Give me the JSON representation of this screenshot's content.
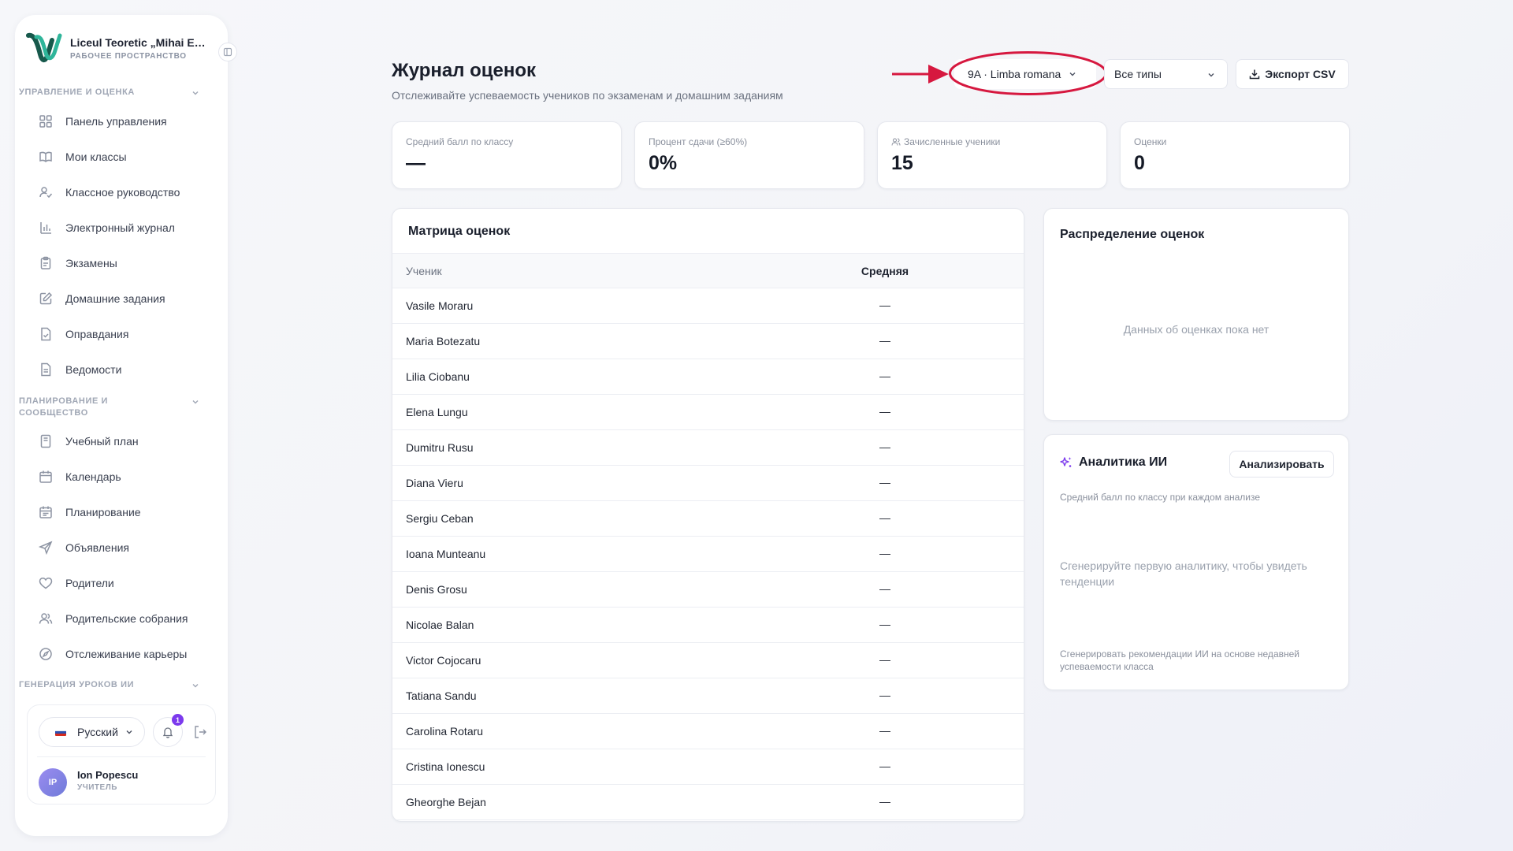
{
  "sidebar": {
    "school_name": "Liceul Teoretic „Mihai Emi...",
    "workspace_label": "РАБОЧЕЕ ПРОСТРАНСТВО",
    "sections": [
      {
        "title": "УПРАВЛЕНИЕ И ОЦЕНКА"
      },
      {
        "title": "ПЛАНИРОВАНИЕ И СООБЩЕСТВО"
      },
      {
        "title": "ГЕНЕРАЦИЯ УРОКОВ ИИ"
      }
    ],
    "items": [
      {
        "label": "Панель управления",
        "icon": "dashboard-icon"
      },
      {
        "label": "Мои классы",
        "icon": "book-icon"
      },
      {
        "label": "Классное руководство",
        "icon": "user-check-icon"
      },
      {
        "label": "Электронный журнал",
        "icon": "bar-chart-icon"
      },
      {
        "label": "Экзамены",
        "icon": "clipboard-icon"
      },
      {
        "label": "Домашние задания",
        "icon": "edit-note-icon"
      },
      {
        "label": "Оправдания",
        "icon": "file-check-icon"
      },
      {
        "label": "Ведомости",
        "icon": "file-text-icon"
      },
      {
        "label": "Учебный план",
        "icon": "notebook-icon"
      },
      {
        "label": "Календарь",
        "icon": "calendar-icon"
      },
      {
        "label": "Планирование",
        "icon": "calendar-check-icon"
      },
      {
        "label": "Объявления",
        "icon": "send-icon"
      },
      {
        "label": "Родители",
        "icon": "heart-icon"
      },
      {
        "label": "Родительские собрания",
        "icon": "users-icon"
      },
      {
        "label": "Отслеживание карьеры",
        "icon": "compass-icon"
      }
    ],
    "language": "Русский",
    "notifications_count": "1",
    "user": {
      "initials": "IP",
      "name": "Ion Popescu",
      "role": "УЧИТЕЛЬ"
    }
  },
  "header": {
    "title": "Журнал оценок",
    "subtitle": "Отслеживайте успеваемость учеников по экзаменам и домашним заданиям",
    "class_select": "9A · Limba romana",
    "type_select": "Все типы",
    "export_label": "Экспорт CSV"
  },
  "stats": [
    {
      "label": "Средний балл по классу",
      "value": "—"
    },
    {
      "label": "Процент сдачи (≥60%)",
      "value": "0%"
    },
    {
      "label": "Зачисленные ученики",
      "value": "15"
    },
    {
      "label": "Оценки",
      "value": "0"
    }
  ],
  "matrix": {
    "title": "Матрица оценок",
    "col_student": "Ученик",
    "col_average": "Средняя",
    "rows": [
      {
        "name": "Vasile Moraru",
        "avg": "—"
      },
      {
        "name": "Maria Botezatu",
        "avg": "—"
      },
      {
        "name": "Lilia Ciobanu",
        "avg": "—"
      },
      {
        "name": "Elena Lungu",
        "avg": "—"
      },
      {
        "name": "Dumitru Rusu",
        "avg": "—"
      },
      {
        "name": "Diana Vieru",
        "avg": "—"
      },
      {
        "name": "Sergiu Ceban",
        "avg": "—"
      },
      {
        "name": "Ioana Munteanu",
        "avg": "—"
      },
      {
        "name": "Denis Grosu",
        "avg": "—"
      },
      {
        "name": "Nicolae Balan",
        "avg": "—"
      },
      {
        "name": "Victor Cojocaru",
        "avg": "—"
      },
      {
        "name": "Tatiana Sandu",
        "avg": "—"
      },
      {
        "name": "Carolina Rotaru",
        "avg": "—"
      },
      {
        "name": "Cristina Ionescu",
        "avg": "—"
      },
      {
        "name": "Gheorghe Bejan",
        "avg": "—"
      }
    ]
  },
  "distribution": {
    "title": "Распределение оценок",
    "empty": "Данных об оценках пока нет"
  },
  "ai": {
    "title": "Аналитика ИИ",
    "analyze_label": "Анализировать",
    "subtitle": "Средний балл по классу при каждом анализе",
    "empty": "Сгенерируйте первую аналитику, чтобы увидеть тенденции",
    "note": "Сгенерировать рекомендации ИИ на основе недавней успеваемости класса"
  },
  "colors": {
    "accent": "#7c3aed",
    "annotation": "#d6183f",
    "logo_dark": "#17594c",
    "logo_light": "#2fb59a"
  }
}
